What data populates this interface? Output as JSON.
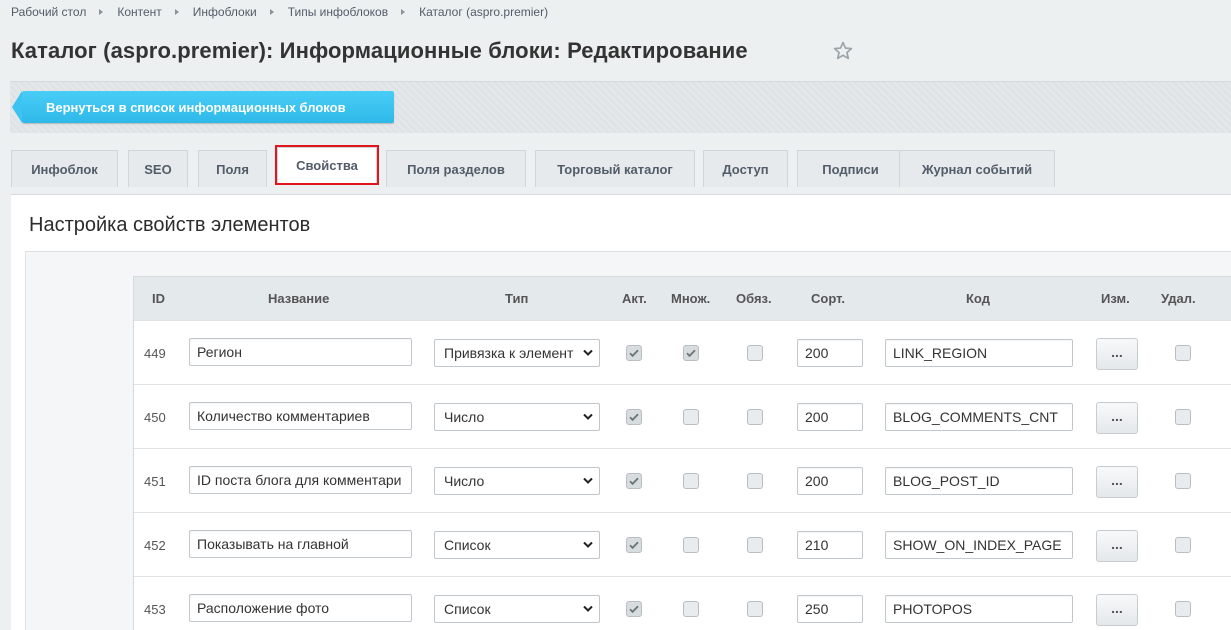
{
  "breadcrumb": [
    "Рабочий стол",
    "Контент",
    "Инфоблоки",
    "Типы инфоблоков",
    "Каталог (aspro.premier)"
  ],
  "page_title": "Каталог (aspro.premier): Информационные блоки: Редактирование",
  "toolbar": {
    "back_label": "Вернуться в список информационных блоков"
  },
  "tabs": [
    {
      "label": "Инфоблок"
    },
    {
      "label": "SEO"
    },
    {
      "label": "Поля"
    },
    {
      "label": "Свойства",
      "active": true
    },
    {
      "label": "Поля разделов"
    },
    {
      "label": "Торговый каталог"
    },
    {
      "label": "Доступ"
    },
    {
      "label": "Подписи"
    },
    {
      "label": "Журнал событий"
    }
  ],
  "section_title": "Настройка свойств элементов",
  "table": {
    "headers": {
      "id": "ID",
      "name": "Название",
      "type": "Тип",
      "active": "Акт.",
      "multiple": "Множ.",
      "required": "Обяз.",
      "sort": "Сорт.",
      "code": "Код",
      "edit": "Изм.",
      "delete": "Удал."
    },
    "edit_button_label": "...",
    "rows": [
      {
        "id": "449",
        "name": "Регион",
        "type": "Привязка к элемент",
        "active": true,
        "multiple": true,
        "required": false,
        "sort": "200",
        "code": "LINK_REGION",
        "delete": false
      },
      {
        "id": "450",
        "name": "Количество комментариев",
        "type": "Число",
        "active": true,
        "multiple": false,
        "required": false,
        "sort": "200",
        "code": "BLOG_COMMENTS_CNT",
        "delete": false
      },
      {
        "id": "451",
        "name": "ID поста блога для комментари",
        "type": "Число",
        "active": true,
        "multiple": false,
        "required": false,
        "sort": "200",
        "code": "BLOG_POST_ID",
        "delete": false
      },
      {
        "id": "452",
        "name": "Показывать на главной",
        "type": "Список",
        "active": true,
        "multiple": false,
        "required": false,
        "sort": "210",
        "code": "SHOW_ON_INDEX_PAGE",
        "delete": false
      },
      {
        "id": "453",
        "name": "Расположение фото",
        "type": "Список",
        "active": true,
        "multiple": false,
        "required": false,
        "sort": "250",
        "code": "PHOTOPOS",
        "delete": false
      }
    ]
  },
  "colors": {
    "accent": "#3bc8f5",
    "highlight": "#e0161c"
  }
}
